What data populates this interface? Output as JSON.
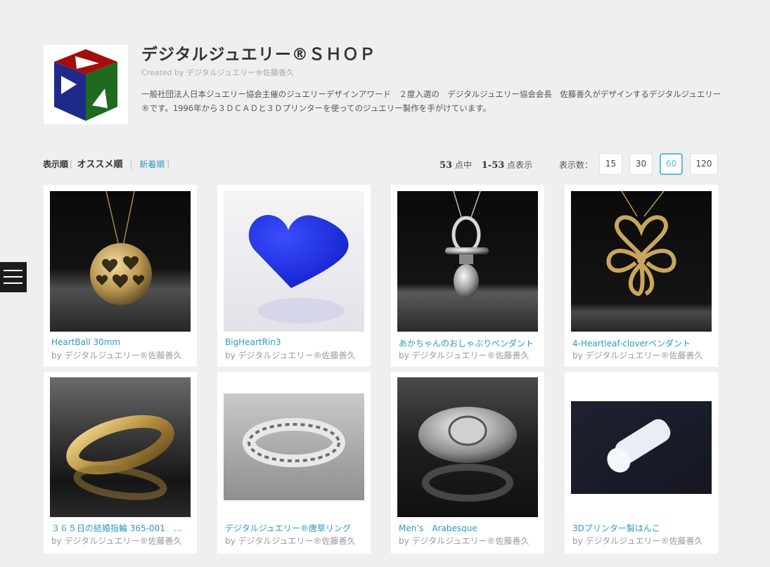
{
  "shop": {
    "title": "デジタルジュエリー®ＳＨＯＰ",
    "created_prefix": "Created by",
    "creator": "デジタルジュエリー®佐藤善久",
    "description": "一般社団法人日本ジュエリー協会主催のジュエリーデザインアワード　２度入選の　デジタルジュエリー協会会長　佐藤善久がデザインするデジタルジュエリー®です。1996年から３ＤＣＡＤと３Ｄプリンターを使ってのジュエリー製作を手がけています。"
  },
  "sort": {
    "label": "表示順",
    "bracket_open": "[",
    "bracket_close": "]",
    "active": "オススメ順",
    "separator": "|",
    "other": "新着順"
  },
  "count": {
    "total": "53",
    "total_suffix": "点中",
    "range": "1-53",
    "range_suffix": "点表示"
  },
  "per_page": {
    "label": "表示数：",
    "options": [
      "15",
      "30",
      "60",
      "120"
    ],
    "selected": "60"
  },
  "products": [
    {
      "name": "HeartBall 30mm",
      "by": "by デジタルジュエリー®佐藤善久",
      "icon": "heart-ball-pendant-image"
    },
    {
      "name": "BigHeartRin3",
      "by": "by デジタルジュエリー®佐藤善久",
      "icon": "blue-heart-image"
    },
    {
      "name": "あかちゃんのおしゃぶりペンダント",
      "by": "by デジタルジュエリー®佐藤善久",
      "icon": "pacifier-pendant-image"
    },
    {
      "name": "4-Heartleaf-cloverペンダント",
      "by": "by デジタルジュエリー®佐藤善久",
      "icon": "clover-pendant-image"
    },
    {
      "name": "３６５日の結婚指輪 365-001　…",
      "by": "by デジタルジュエリー®佐藤善久",
      "icon": "gold-ring-image"
    },
    {
      "name": "デジタルジュエリー®唐草リング",
      "by": "by デジタルジュエリー®佐藤善久",
      "icon": "silver-arabesque-ring-image"
    },
    {
      "name": "Men’s　Arabesque",
      "by": "by デジタルジュエリー®佐藤善久",
      "icon": "mens-ring-image"
    },
    {
      "name": "3Dプリンター製はんこ",
      "by": "by デジタルジュエリー®佐藤善久",
      "icon": "printed-stamp-image"
    }
  ],
  "colors": {
    "link": "#2a9bc0",
    "active_border": "#5bbde0",
    "background": "#efefef",
    "logo_red": "#a50d0d",
    "logo_blue": "#1e2a8a",
    "logo_green": "#1e6a1e"
  }
}
